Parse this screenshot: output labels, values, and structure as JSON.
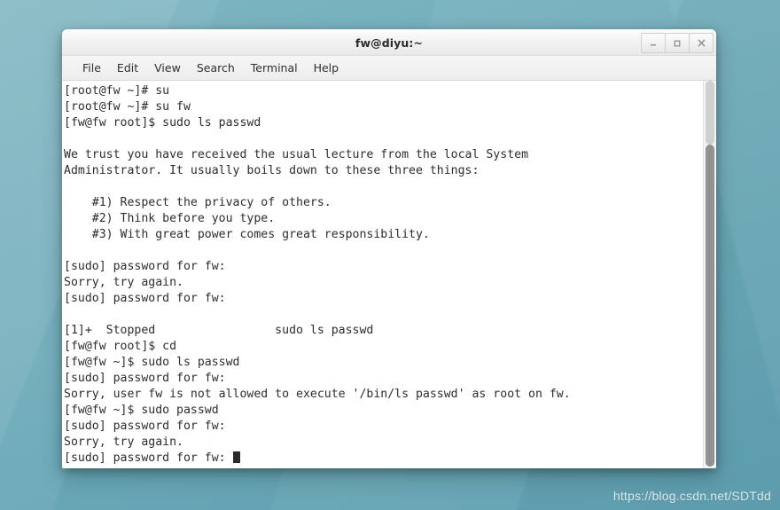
{
  "desktop": {
    "background_color": "#71adbb",
    "watermark": "https://blog.csdn.net/SDTdd"
  },
  "window": {
    "title": "fw@diyu:~",
    "controls": {
      "minimize_label": "_",
      "maximize_label": "□",
      "close_label": "✕"
    },
    "menubar": [
      {
        "label": "File"
      },
      {
        "label": "Edit"
      },
      {
        "label": "View"
      },
      {
        "label": "Search"
      },
      {
        "label": "Terminal"
      },
      {
        "label": "Help"
      }
    ]
  },
  "terminal": {
    "foreground_color": "#2d2d2d",
    "background_color": "#ffffff",
    "lines": [
      "[root@fw ~]# su",
      "[root@fw ~]# su fw",
      "[fw@fw root]$ sudo ls passwd",
      "",
      "We trust you have received the usual lecture from the local System",
      "Administrator. It usually boils down to these three things:",
      "",
      "    #1) Respect the privacy of others.",
      "    #2) Think before you type.",
      "    #3) With great power comes great responsibility.",
      "",
      "[sudo] password for fw:",
      "Sorry, try again.",
      "[sudo] password for fw:",
      "",
      "[1]+  Stopped                 sudo ls passwd",
      "[fw@fw root]$ cd",
      "[fw@fw ~]$ sudo ls passwd",
      "[sudo] password for fw:",
      "Sorry, user fw is not allowed to execute '/bin/ls passwd' as root on fw.",
      "[fw@fw ~]$ sudo passwd",
      "[sudo] password for fw:",
      "Sorry, try again."
    ],
    "prompt_line": "[sudo] password for fw: ",
    "cursor_visible": true
  }
}
